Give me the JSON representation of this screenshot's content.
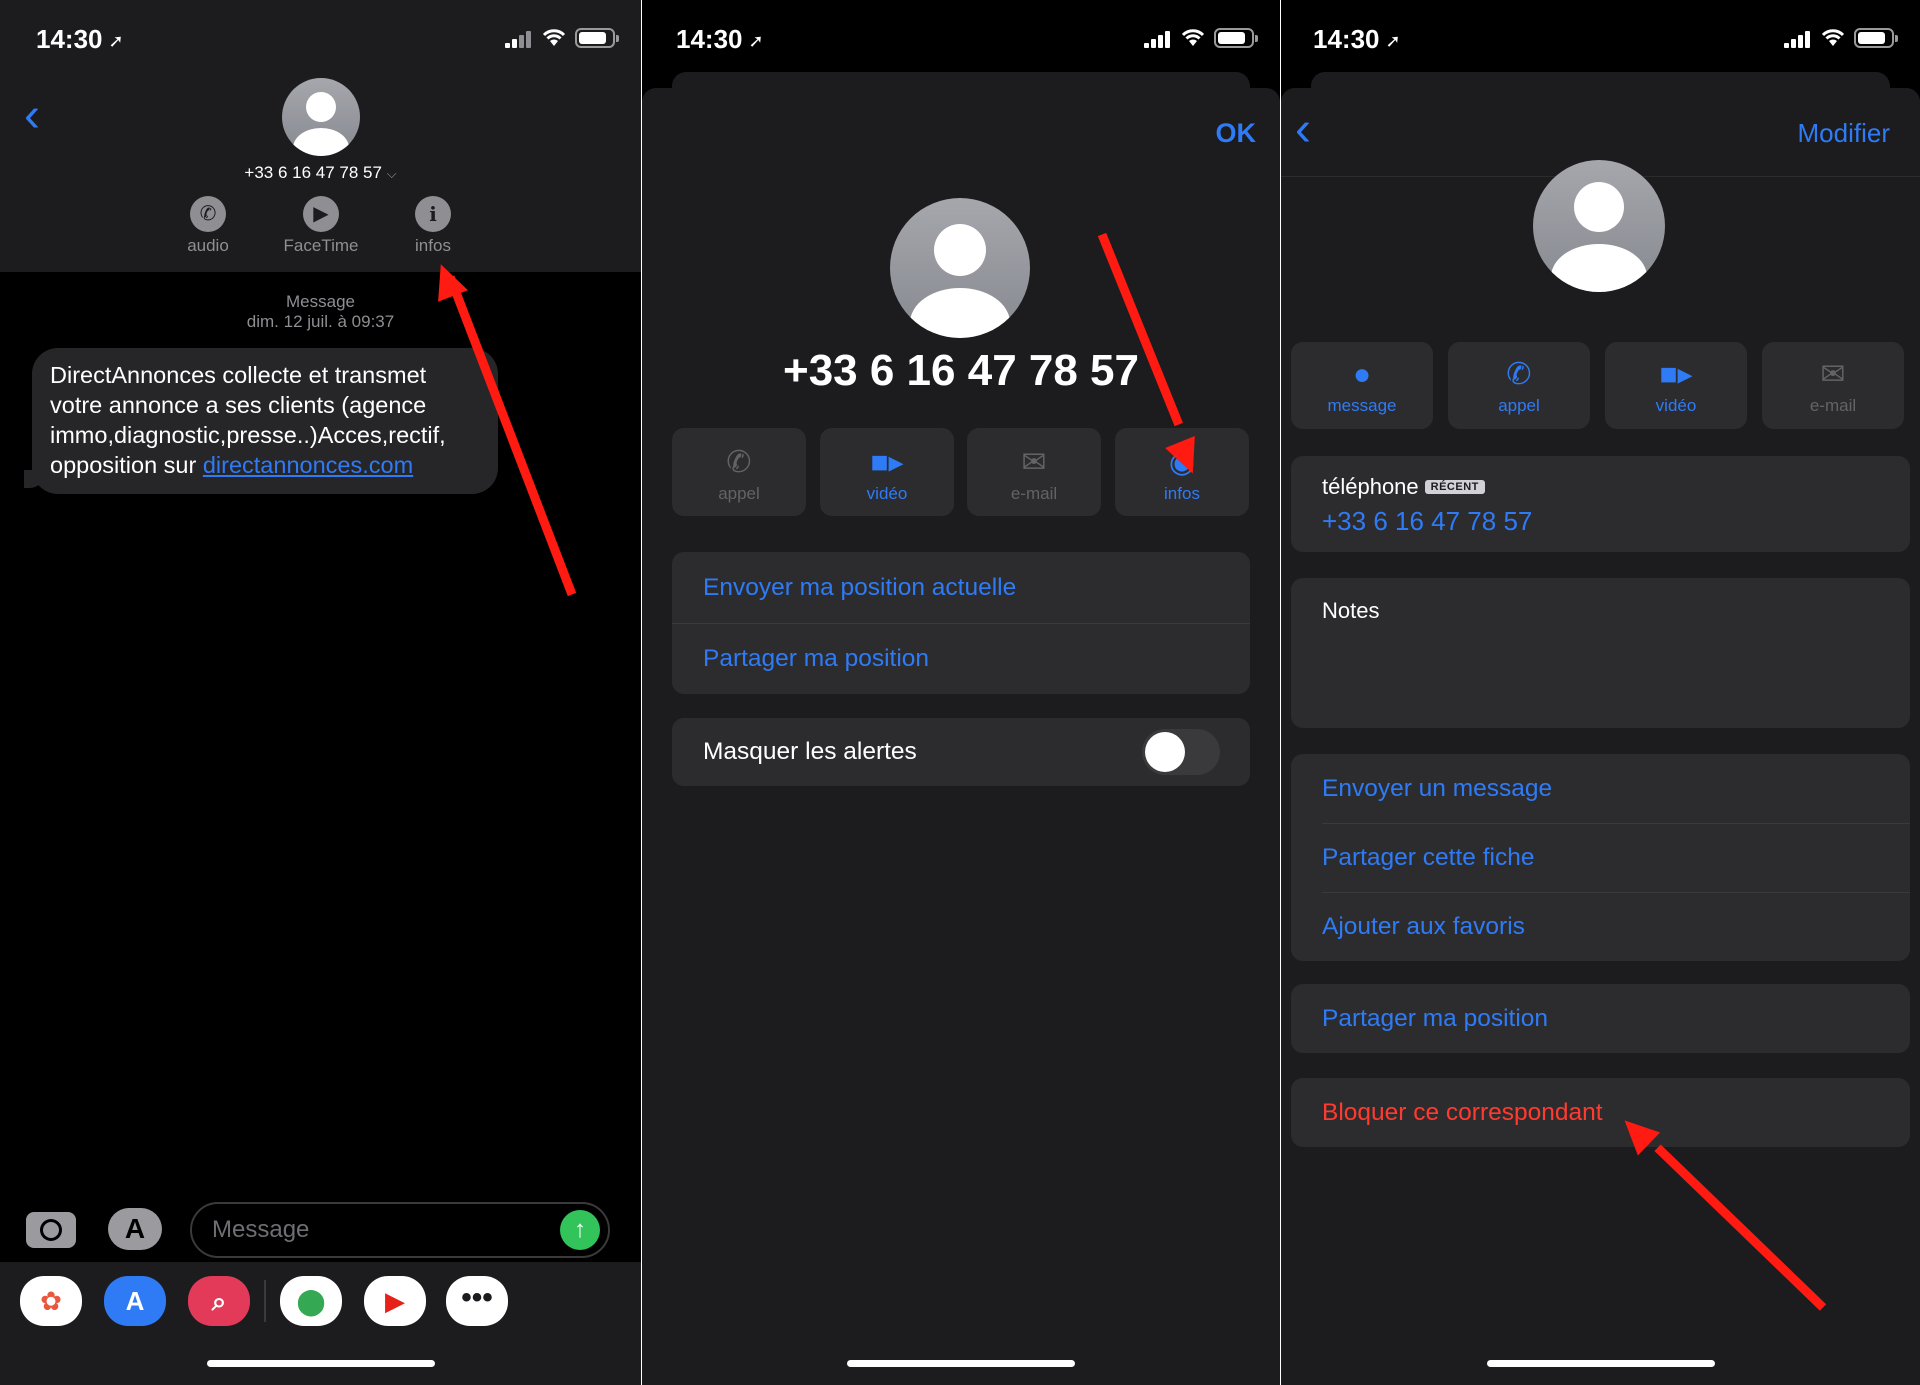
{
  "status": {
    "time": "14:30"
  },
  "screen1": {
    "contact_number": "+33 6 16 47 78 57",
    "actions": [
      {
        "label": "audio",
        "icon": "phone-icon"
      },
      {
        "label": "FaceTime",
        "icon": "video-camera-icon"
      },
      {
        "label": "infos",
        "icon": "info-icon"
      }
    ],
    "message_meta_line1": "Message",
    "message_meta_line2": "dim. 12 juil. à 09:37",
    "message_text": "DirectAnnonces collecte et transmet votre annonce a ses clients (agence immo,diagnostic,presse..)Acces,rectif, opposition sur ",
    "message_link": "directannonces.com",
    "input_placeholder": "Message",
    "dock_apps": [
      "photos-icon",
      "app-store-icon",
      "search-web-icon",
      "maps-icon",
      "youtube-icon",
      "more-icon"
    ]
  },
  "screen2": {
    "ok_label": "OK",
    "contact_number": "+33 6 16 47 78 57",
    "actions": [
      {
        "label": "appel",
        "icon": "phone-icon",
        "enabled": false
      },
      {
        "label": "vidéo",
        "icon": "video-camera-icon",
        "enabled": true
      },
      {
        "label": "e-mail",
        "icon": "envelope-icon",
        "enabled": false
      },
      {
        "label": "infos",
        "icon": "person-circle-icon",
        "enabled": true
      }
    ],
    "location_rows": [
      "Envoyer ma position actuelle",
      "Partager ma position"
    ],
    "hide_alerts_label": "Masquer les alertes",
    "hide_alerts_on": false
  },
  "screen3": {
    "modify_label": "Modifier",
    "actions": [
      {
        "label": "message",
        "icon": "speech-bubble-icon",
        "enabled": true
      },
      {
        "label": "appel",
        "icon": "phone-icon",
        "enabled": true
      },
      {
        "label": "vidéo",
        "icon": "video-camera-icon",
        "enabled": true
      },
      {
        "label": "e-mail",
        "icon": "envelope-icon",
        "enabled": false
      }
    ],
    "phone_label": "téléphone",
    "recent_badge": "RÉCENT",
    "phone_value": "+33 6 16 47 78 57",
    "notes_label": "Notes",
    "contact_rows": [
      "Envoyer un message",
      "Partager cette fiche",
      "Ajouter aux favoris"
    ],
    "share_location": "Partager ma position",
    "block_label": "Bloquer ce correspondant"
  },
  "colors": {
    "accent": "#2f7bf6",
    "destructive": "#ff3b30",
    "annotation": "#ff1a12"
  }
}
